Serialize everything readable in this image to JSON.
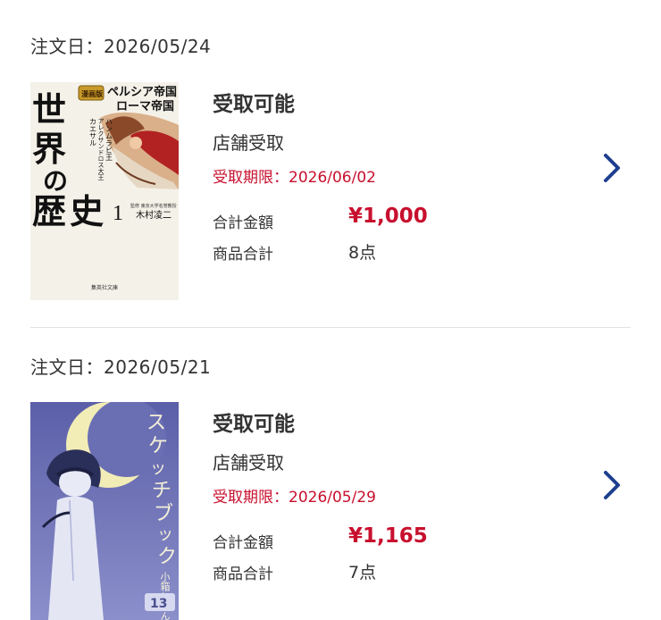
{
  "orders": [
    {
      "date_label": "注文日：2026/05/24",
      "cover": {
        "badge": "漫画版",
        "title_chars": [
          "世",
          "界",
          "の",
          "歴",
          "史"
        ],
        "volume": "1",
        "subtitle_lines": [
          "ペルシア帝国と",
          "ローマ帝国"
        ],
        "side_lines": [
          "ハンムラビ王",
          "アレクサンドロス大王",
          "カエサル"
        ],
        "supervisor": "監修 東京大学名誉教授",
        "author": "木村凌二",
        "publisher": "集英社文庫"
      },
      "status": "受取可能",
      "method": "店舗受取",
      "deadline": "受取期限：2026/06/02",
      "total_label": "合計金額",
      "total_value": "¥1,000",
      "items_label": "商品合計",
      "items_value": "8点"
    },
    {
      "date_label": "注文日：2026/05/21",
      "cover": {
        "title_chars": [
          "ス",
          "ケ",
          "ッ",
          "チ",
          "ブ",
          "ッ",
          "ク"
        ],
        "author": "小箱とたん",
        "volume": "13"
      },
      "status": "受取可能",
      "method": "店舗受取",
      "deadline": "受取期限：2026/05/29",
      "total_label": "合計金額",
      "total_value": "¥1,165",
      "items_label": "商品合計",
      "items_value": "7点"
    }
  ],
  "icons": {
    "chevron": "chevron-right-icon"
  },
  "colors": {
    "accent_red": "#c8102e",
    "chevron_blue": "#1d3f8f",
    "divider": "#e2e2e2",
    "text": "#333333"
  }
}
